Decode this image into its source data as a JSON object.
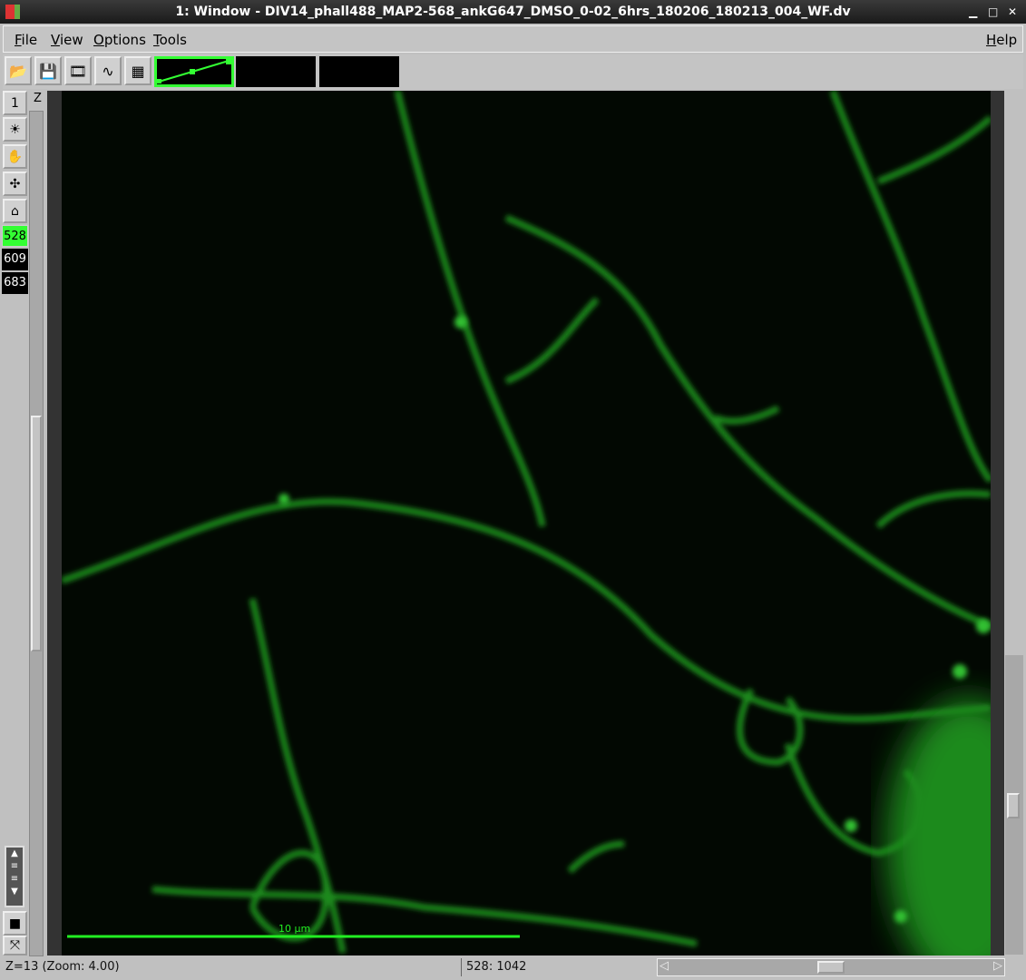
{
  "window": {
    "title": "1: Window - DIV14_phall488_MAP2-568_ankG647_DMSO_0-02_6hrs_180206_180213_004_WF.dv"
  },
  "menu": {
    "file": "File",
    "view": "View",
    "options": "Options",
    "tools": "Tools",
    "help": "Help"
  },
  "toolbar": {
    "icons": [
      "open-icon",
      "save-icon",
      "movie-icon",
      "waveform-icon",
      "table-icon"
    ]
  },
  "left": {
    "view_number": "1",
    "z_label": "Z",
    "channels": [
      "528",
      "609",
      "683"
    ],
    "active_channel_color": "#33ff33"
  },
  "image": {
    "scale_bar_label": "10 µm",
    "color": "#22cc22"
  },
  "status": {
    "z_zoom": "Z=13  (Zoom: 4.00)",
    "coords": "528: 1042"
  }
}
